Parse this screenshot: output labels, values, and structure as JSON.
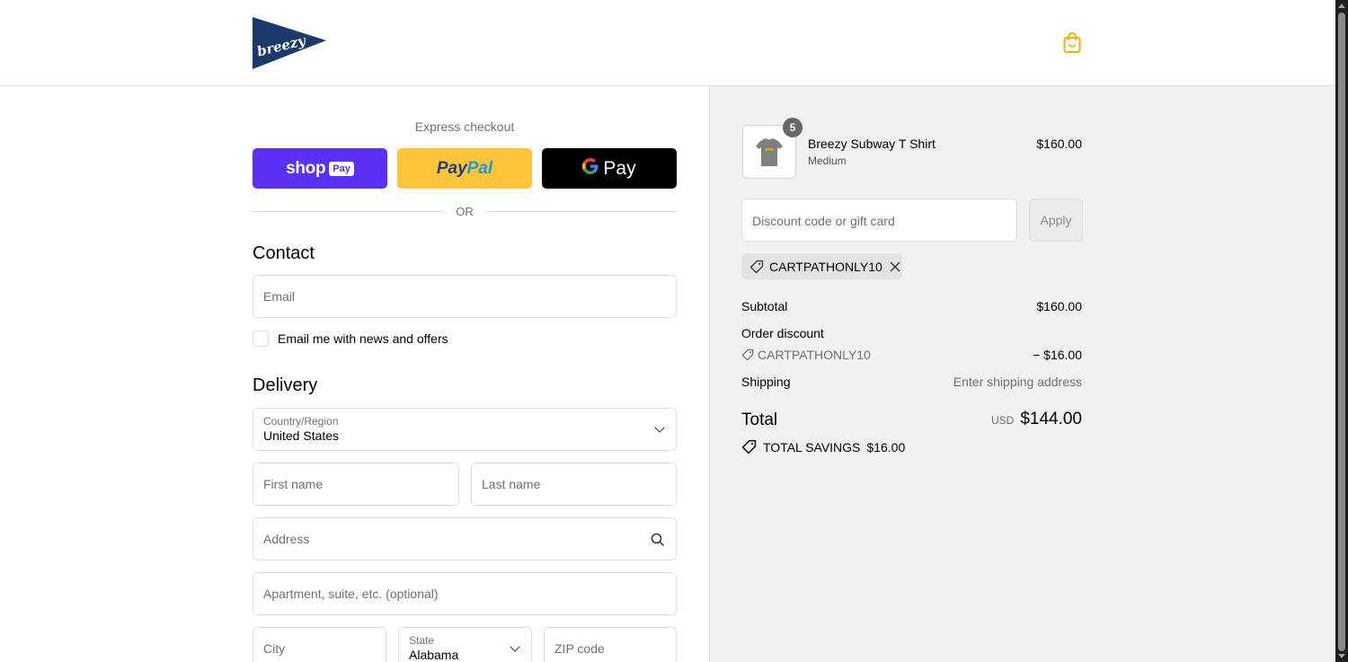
{
  "header": {
    "logo_text": "breezy",
    "cart_icon": "shopping-bag-icon",
    "brand_color": "#1b3a6b",
    "cart_color": "#f0b000"
  },
  "express": {
    "label": "Express checkout",
    "shop_pay": {
      "shop": "shop",
      "pay": "Pay"
    },
    "paypal": {
      "part1": "Pay",
      "part2": "Pal"
    },
    "gpay": {
      "g": "G",
      "pay": "Pay"
    },
    "or": "OR"
  },
  "contact": {
    "title": "Contact",
    "email_placeholder": "Email",
    "newsletter_label": "Email me with news and offers"
  },
  "delivery": {
    "title": "Delivery",
    "country_label": "Country/Region",
    "country_value": "United States",
    "first_name_placeholder": "First name",
    "last_name_placeholder": "Last name",
    "address_placeholder": "Address",
    "apartment_placeholder": "Apartment, suite, etc. (optional)",
    "city_placeholder": "City",
    "state_label": "State",
    "state_value": "Alabama",
    "zip_placeholder": "ZIP code"
  },
  "summary": {
    "item": {
      "name": "Breezy Subway T Shirt",
      "variant": "Medium",
      "price": "$160.00",
      "quantity": "5"
    },
    "discount_placeholder": "Discount code or gift card",
    "apply_label": "Apply",
    "applied_code": "CARTPATHONLY10",
    "subtotal_label": "Subtotal",
    "subtotal_value": "$160.00",
    "order_discount_label": "Order discount",
    "order_discount_code": "CARTPATHONLY10",
    "order_discount_value": "− $16.00",
    "shipping_label": "Shipping",
    "shipping_value": "Enter shipping address",
    "total_label": "Total",
    "total_currency": "USD",
    "total_value": "$144.00",
    "savings_label": "TOTAL SAVINGS",
    "savings_value": "$16.00"
  }
}
